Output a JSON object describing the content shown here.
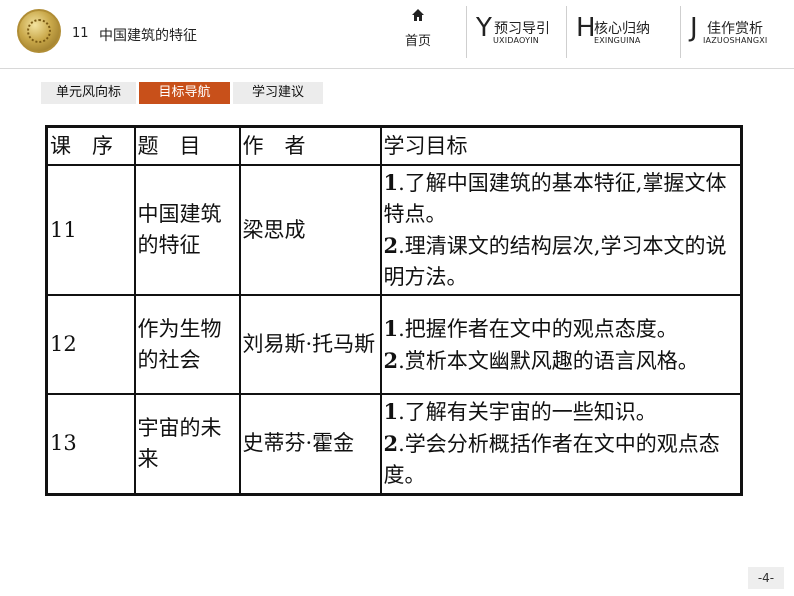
{
  "header": {
    "lesson_number": "11",
    "lesson_title": "中国建筑的特征",
    "home_label": "首页",
    "nav": [
      {
        "letter": "Y",
        "label_cn": "预习导引",
        "label_en": "UXIDAOYIN"
      },
      {
        "letter": "H",
        "label_cn": "核心归纳",
        "label_en": "EXINGUINA"
      },
      {
        "letter": "J",
        "label_cn": "佳作赏析",
        "label_en": "IAZUOSHANGXI"
      }
    ]
  },
  "tabs": [
    {
      "label": "单元风向标",
      "active": false
    },
    {
      "label": "目标导航",
      "active": true
    },
    {
      "label": "学习建议",
      "active": false
    }
  ],
  "colors": {
    "accent": "#c8501a",
    "tab_inactive": "#ececec"
  },
  "table": {
    "headers": [
      "课　序",
      "题　目",
      "作　者",
      "学习目标"
    ],
    "rows": [
      {
        "num": "11",
        "title": "中国建筑的特征",
        "author": "梁思成",
        "goals": [
          {
            "n": "1",
            "text": ".了解中国建筑的基本特征,掌握文体特点。"
          },
          {
            "n": "2",
            "text": ".理清课文的结构层次,学习本文的说明方法。"
          }
        ]
      },
      {
        "num": "12",
        "title": "作为生物的社会",
        "author": "刘易斯·托马斯",
        "goals": [
          {
            "n": "1",
            "text": ".把握作者在文中的观点态度。"
          },
          {
            "n": "2",
            "text": ".赏析本文幽默风趣的语言风格。"
          }
        ]
      },
      {
        "num": "13",
        "title": "宇宙的未来",
        "author": "史蒂芬·霍金",
        "goals": [
          {
            "n": "1",
            "text": ".了解有关宇宙的一些知识。"
          },
          {
            "n": "2",
            "text": ".学会分析概括作者在文中的观点态度。"
          }
        ]
      }
    ]
  },
  "page_number": "-4-"
}
